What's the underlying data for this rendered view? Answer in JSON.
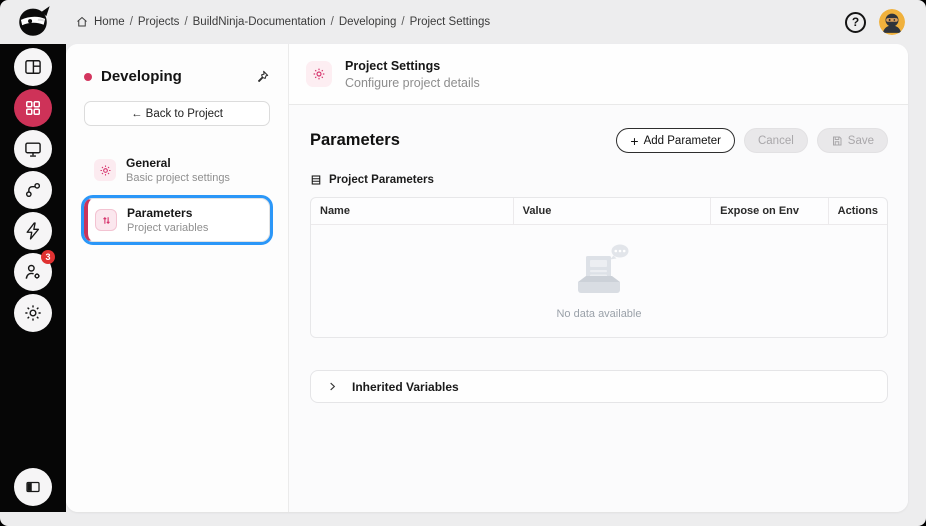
{
  "topbar": {
    "breadcrumb": [
      "Home",
      "Projects",
      "BuildNinja-Documentation",
      "Developing",
      "Project Settings"
    ],
    "separator": "/",
    "help": "?"
  },
  "sidebar": {
    "icons": [
      "layout-dashboard",
      "apps-grid",
      "monitor",
      "git-branch",
      "lightning-bolt",
      "user-settings",
      "gear",
      "panel-toggle"
    ],
    "selected": "apps-grid",
    "notification_badge": "3"
  },
  "project_panel": {
    "title": "Developing",
    "back_button": "← Back to Project",
    "items": [
      {
        "title": "General",
        "subtitle": "Basic project settings",
        "icon": "gear-icon"
      },
      {
        "title": "Parameters",
        "subtitle": "Project variables",
        "icon": "variables-icon",
        "selected": true
      }
    ]
  },
  "content_header": {
    "title": "Project Settings",
    "subtitle": "Configure project details",
    "icon": "gear-icon"
  },
  "parameters": {
    "heading": "Parameters",
    "add_plus": "+",
    "add_button": "Add Parameter",
    "cancel_button": "Cancel",
    "save_button": "Save",
    "section_label": "Project Parameters",
    "table": {
      "columns": [
        "Name",
        "Value",
        "Expose on Env",
        "Actions"
      ]
    },
    "empty_text": "No data available",
    "inherited_section": "Inherited Variables"
  },
  "colors": {
    "accent": "#ce3258",
    "selected_outline": "#2b97f8",
    "badge": "#e03131",
    "avatar_bg": "#f0b13c",
    "pink_icon": "#d6336c"
  }
}
